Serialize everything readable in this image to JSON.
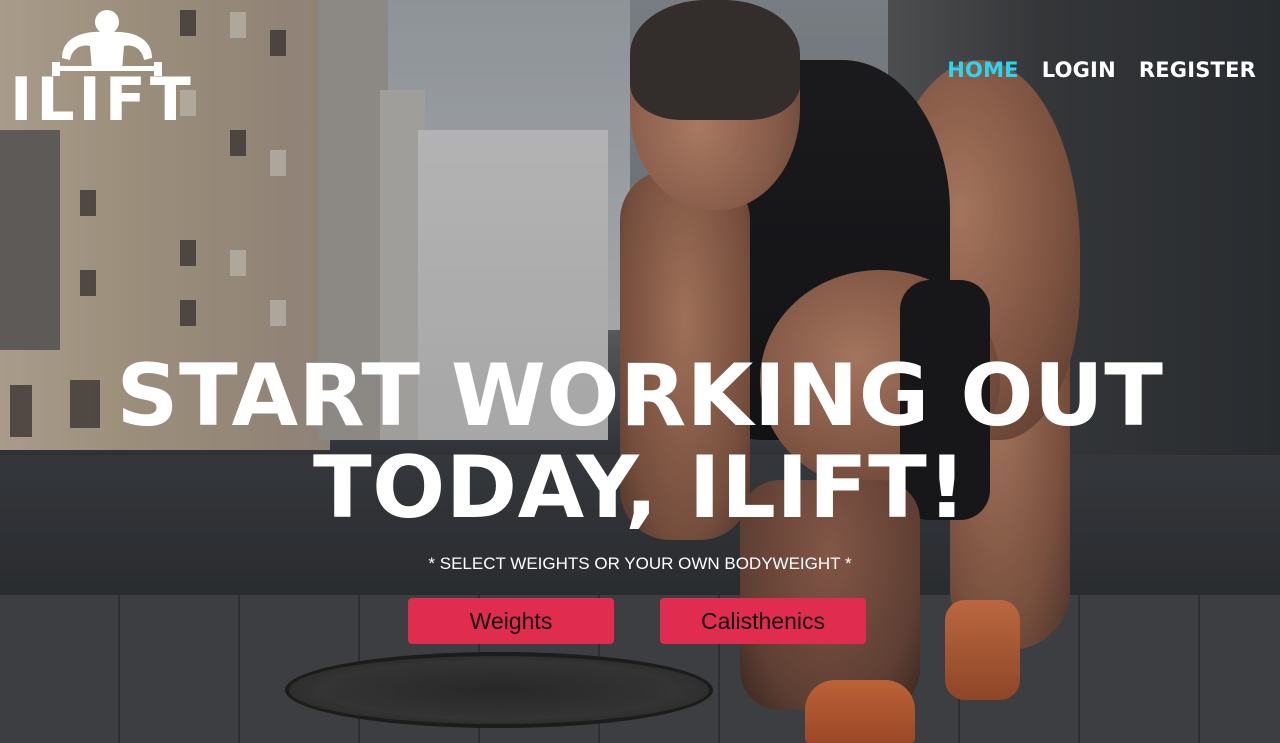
{
  "brand": {
    "logo_text": "ILIFT",
    "logo_icon": "bodybuilder-icon"
  },
  "nav": {
    "items": [
      {
        "label": "HOME",
        "active": true
      },
      {
        "label": "LOGIN",
        "active": false
      },
      {
        "label": "REGISTER",
        "active": false
      }
    ],
    "active_color": "#27d6f5"
  },
  "hero": {
    "headline_line1": "START WORKING OUT",
    "headline_line2": "TODAY, ILIFT!",
    "subline": "* SELECT WEIGHTS OR YOUR OWN BODYWEIGHT *",
    "buttons": [
      {
        "label": "Weights"
      },
      {
        "label": "Calisthenics"
      }
    ],
    "button_color": "#e02c4f"
  }
}
